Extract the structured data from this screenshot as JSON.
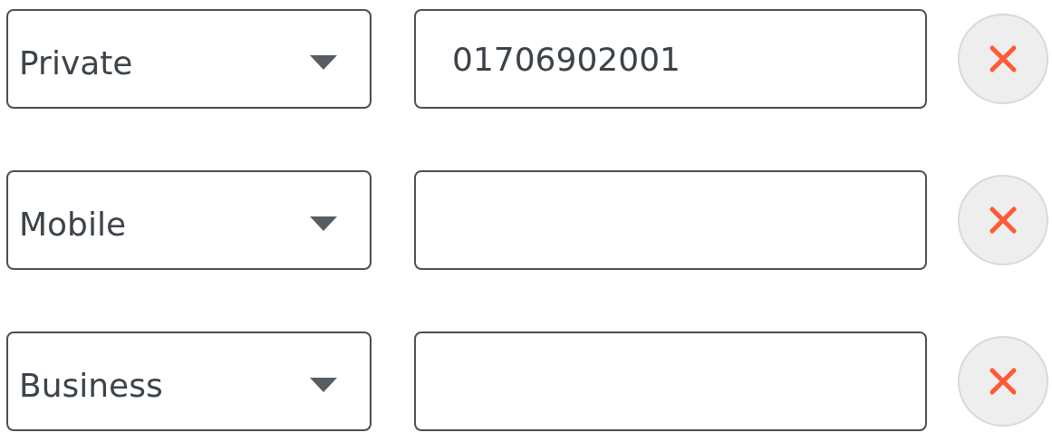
{
  "phone_numbers": [
    {
      "type": "Private",
      "value": "01706902001"
    },
    {
      "type": "Mobile"
    },
    {
      "type": "Business"
    }
  ]
}
